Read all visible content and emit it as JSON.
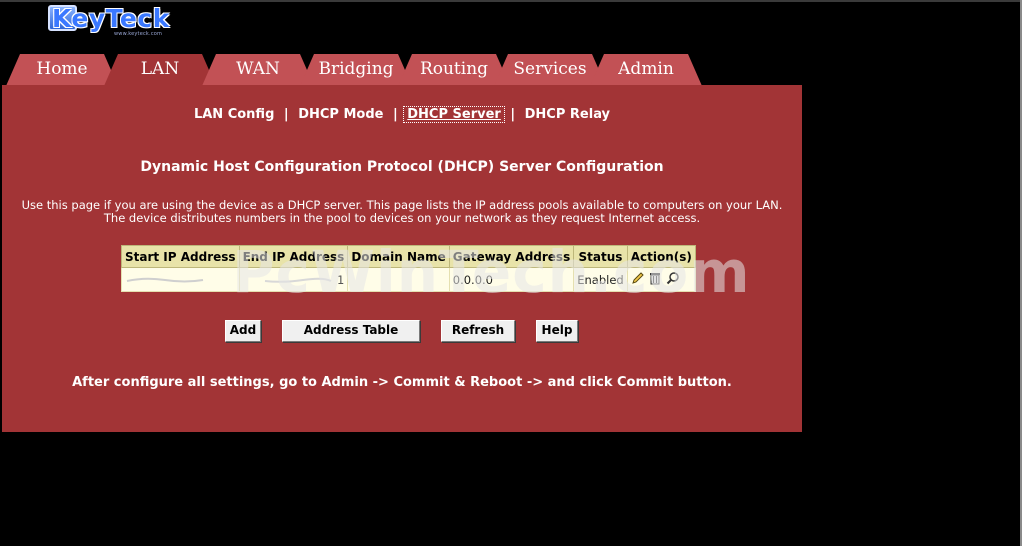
{
  "logo": {
    "text": "KeyTeck",
    "subtext": "www.keyteck.com"
  },
  "tabs": [
    {
      "label": "Home"
    },
    {
      "label": "LAN"
    },
    {
      "label": "WAN"
    },
    {
      "label": "Bridging"
    },
    {
      "label": "Routing"
    },
    {
      "label": "Services"
    },
    {
      "label": "Admin"
    }
  ],
  "active_tab": "LAN",
  "subnav": {
    "items": [
      "LAN Config",
      "DHCP Mode",
      "DHCP Server",
      "DHCP Relay"
    ],
    "current": "DHCP Server"
  },
  "page": {
    "title": "Dynamic Host Configuration Protocol (DHCP) Server Configuration",
    "description_line1": "Use this page if you are using the device as a DHCP server. This page lists the IP address pools available to computers on your LAN.",
    "description_line2": "The device distributes numbers in the pool to devices on your network as they request Internet access."
  },
  "table": {
    "headers": [
      "Start IP Address",
      "End IP Address",
      "Domain Name",
      "Gateway Address",
      "Status",
      "Action(s)"
    ],
    "rows": [
      {
        "start_ip": "",
        "end_ip": "1",
        "domain": "",
        "gateway": "0.0.0.0",
        "status": "Enabled"
      }
    ]
  },
  "buttons": {
    "add": "Add",
    "address_table": "Address Table",
    "refresh": "Refresh",
    "help": "Help"
  },
  "note": "After configure all settings, go to Admin -> Commit & Reboot -> and click Commit button.",
  "watermark": "PcWinTech.com",
  "colors": {
    "panel": "#a23436",
    "tab": "#c25155",
    "table_header": "#e8e3a9",
    "table_row": "#fffde8",
    "page_background": "#000000"
  }
}
